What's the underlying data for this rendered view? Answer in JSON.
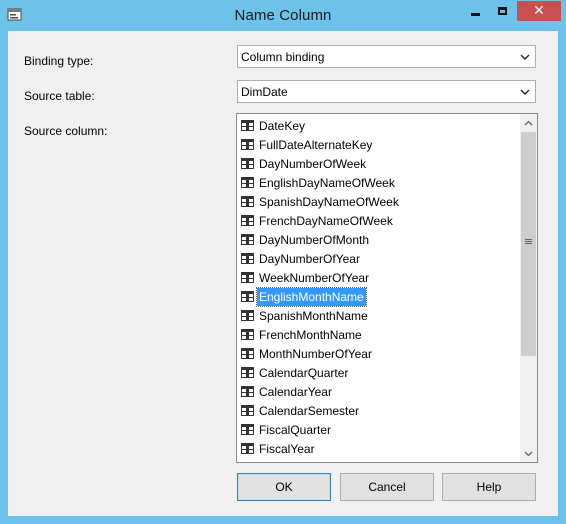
{
  "window": {
    "title": "Name Column",
    "close_symbol": "✕"
  },
  "fields": {
    "binding_type": {
      "label": "Binding type:",
      "value": "Column binding"
    },
    "source_table": {
      "label": "Source table:",
      "value": "DimDate"
    },
    "source_column": {
      "label": "Source column:"
    }
  },
  "columns": [
    "DateKey",
    "FullDateAlternateKey",
    "DayNumberOfWeek",
    "EnglishDayNameOfWeek",
    "SpanishDayNameOfWeek",
    "FrenchDayNameOfWeek",
    "DayNumberOfMonth",
    "DayNumberOfYear",
    "WeekNumberOfYear",
    "EnglishMonthName",
    "SpanishMonthName",
    "FrenchMonthName",
    "MonthNumberOfYear",
    "CalendarQuarter",
    "CalendarYear",
    "CalendarSemester",
    "FiscalQuarter",
    "FiscalYear"
  ],
  "selected_column": "EnglishMonthName",
  "buttons": {
    "ok": "OK",
    "cancel": "Cancel",
    "help": "Help"
  },
  "icons": {
    "window": "dialog-app-icon",
    "column": "table-column-icon",
    "dropdown": "chevron-down-icon"
  }
}
